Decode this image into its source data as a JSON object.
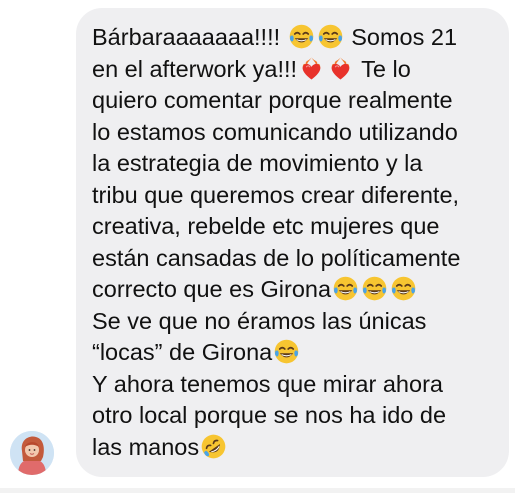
{
  "message": {
    "lines": [
      {
        "segments": [
          {
            "t": "text",
            "v": "Bárbaraaaaaaa!!!! "
          },
          {
            "t": "emoji",
            "icon": "face-with-tears-of-joy-icon"
          },
          {
            "t": "emoji",
            "icon": "face-with-tears-of-joy-icon"
          },
          {
            "t": "text",
            "v": " Somos 21"
          }
        ]
      },
      {
        "segments": [
          {
            "t": "text",
            "v": "en el afterwork ya!!!"
          },
          {
            "t": "emoji",
            "icon": "heart-on-fire-icon"
          },
          {
            "t": "emoji",
            "icon": "heart-on-fire-icon"
          },
          {
            "t": "text",
            "v": " Te lo"
          }
        ]
      },
      {
        "segments": [
          {
            "t": "text",
            "v": "quiero comentar porque realmente"
          }
        ]
      },
      {
        "segments": [
          {
            "t": "text",
            "v": "lo estamos comunicando utilizando"
          }
        ]
      },
      {
        "segments": [
          {
            "t": "text",
            "v": "la estrategia de movimiento y la"
          }
        ]
      },
      {
        "segments": [
          {
            "t": "text",
            "v": "tribu que queremos crear diferente,"
          }
        ]
      },
      {
        "segments": [
          {
            "t": "text",
            "v": "creativa, rebelde etc mujeres que"
          }
        ]
      },
      {
        "segments": [
          {
            "t": "text",
            "v": "están cansadas de lo políticamente"
          }
        ]
      },
      {
        "segments": [
          {
            "t": "text",
            "v": "correcto que es Girona"
          },
          {
            "t": "emoji",
            "icon": "face-with-tears-of-joy-icon"
          },
          {
            "t": "emoji",
            "icon": "face-with-tears-of-joy-icon"
          },
          {
            "t": "emoji",
            "icon": "face-with-tears-of-joy-icon"
          }
        ]
      },
      {
        "segments": [
          {
            "t": "text",
            "v": "Se ve que no éramos las únicas"
          }
        ]
      },
      {
        "segments": [
          {
            "t": "text",
            "v": "“locas” de Girona"
          },
          {
            "t": "emoji",
            "icon": "face-with-tears-of-joy-icon"
          }
        ]
      },
      {
        "segments": [
          {
            "t": "text",
            "v": "Y ahora tenemos que mirar ahora"
          }
        ]
      },
      {
        "segments": [
          {
            "t": "text",
            "v": "otro local porque se nos ha ido de"
          }
        ]
      },
      {
        "segments": [
          {
            "t": "text",
            "v": "las manos"
          },
          {
            "t": "emoji",
            "icon": "rolling-on-the-floor-laughing-icon"
          }
        ]
      }
    ]
  },
  "sender": {
    "avatar_icon": "avatar"
  },
  "colors": {
    "bubble_bg": "#efeff1",
    "text": "#111111",
    "emoji_yellow": "#f7c531",
    "tear_blue": "#4aa3e8",
    "fire_orange": "#f2792b",
    "heart_red": "#e8322b"
  }
}
